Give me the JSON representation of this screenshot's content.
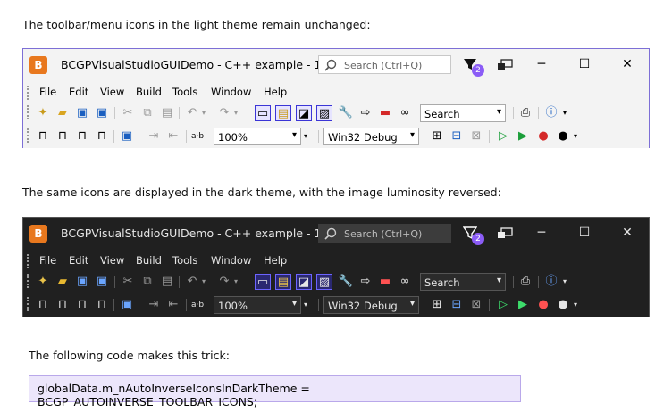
{
  "captions": {
    "light": "The toolbar/menu icons in the light theme remain unchanged:",
    "dark": "The same icons are displayed in the dark theme, with the image luminosity reversed:",
    "code_intro": "The following code makes this trick:"
  },
  "window": {
    "logo": "B",
    "title": "BCGPVisualStudioGUIDemo - C++ example - 1",
    "search_placeholder": "Search (Ctrl+Q)",
    "notification_count": "2",
    "minimize": "─",
    "maximize": "☐",
    "close": "✕"
  },
  "menu": [
    "File",
    "Edit",
    "View",
    "Build",
    "Tools",
    "Window",
    "Help"
  ],
  "toolbar": {
    "search_combo": "Search",
    "zoom_label": "a·b",
    "zoom_value": "100%",
    "config_value": "Win32 Debug"
  },
  "code": "globalData.m_nAutoInverseIconsInDarkTheme = BCGP_AUTOINVERSE_TOOLBAR_ICONS;",
  "colors": {
    "accent": "#7d6fd6",
    "badge": "#8b5cf6",
    "code_bg": "#ece6fb",
    "dark_bg": "#202020"
  }
}
